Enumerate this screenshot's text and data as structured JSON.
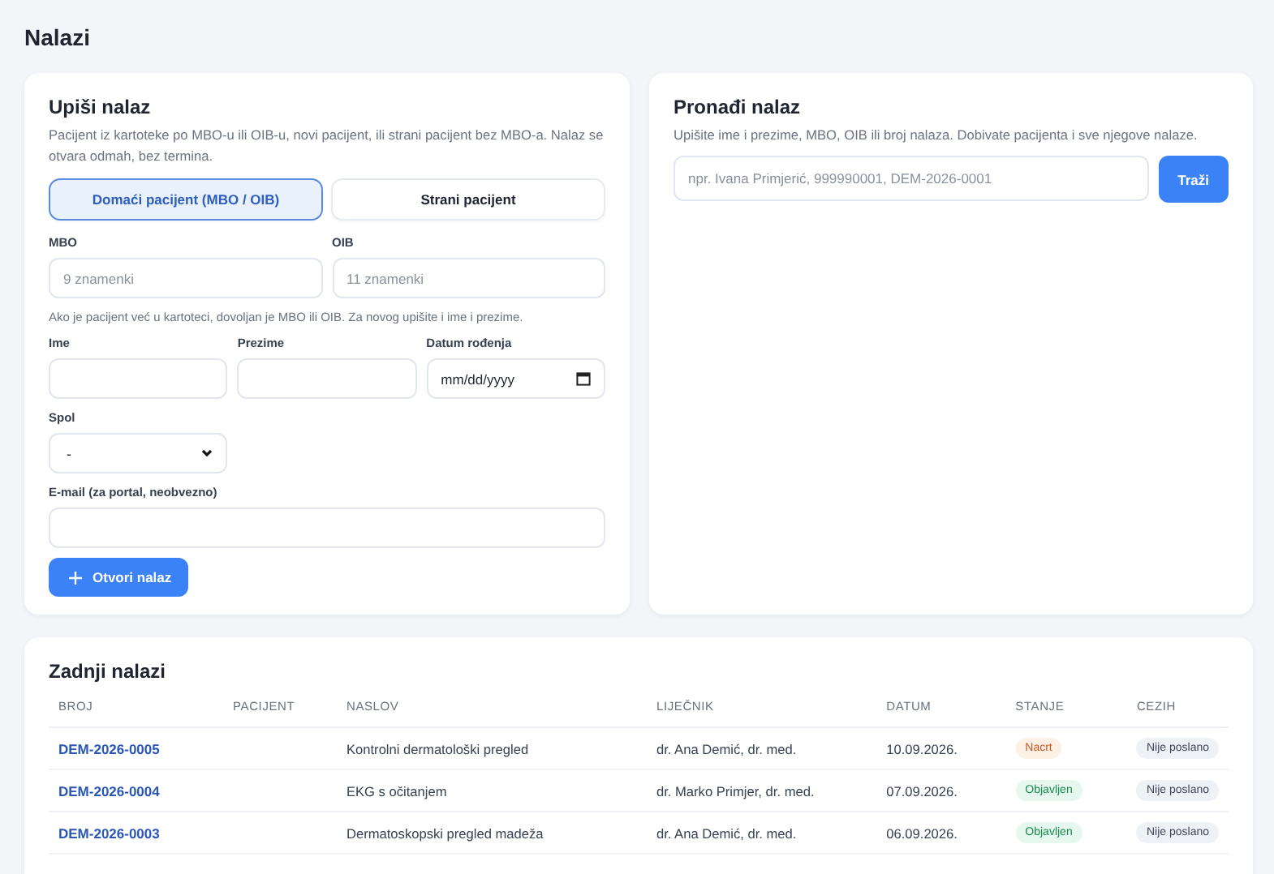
{
  "page": {
    "title": "Nalazi"
  },
  "new_finding": {
    "title": "Upiši nalaz",
    "description": "Pacijent iz kartoteke po MBO-u ili OIB-u, novi pacijent, ili strani pacijent bez MBO-a. Nalaz se otvara odmah, bez termina.",
    "patient_tabs": [
      {
        "label": "Domaći pacijent (MBO / OIB)",
        "selected": true
      },
      {
        "label": "Strani pacijent",
        "selected": false
      }
    ],
    "id_fields": [
      {
        "label": "MBO",
        "placeholder": "9 znamenki"
      },
      {
        "label": "OIB",
        "placeholder": "11 znamenki"
      }
    ],
    "hint": "Ako je pacijent već u kartoteci, dovoljan je MBO ili OIB. Za novog upišite i ime i prezime.",
    "name_fields": [
      {
        "label": "Ime",
        "kind": "text"
      },
      {
        "label": "Prezime",
        "kind": "text"
      },
      {
        "label": "Datum rođenja",
        "kind": "date",
        "placeholder": "mm/dd/yyyy"
      }
    ],
    "gender": {
      "label": "Spol",
      "value": "-"
    },
    "email": {
      "label": "E-mail (za portal, neobvezno)"
    },
    "submit_button": {
      "label": "Otvori nalaz"
    }
  },
  "find_finding": {
    "title": "Pronađi nalaz",
    "description": "Upišite ime i prezime, MBO, OIB ili broj nalaza. Dobivate pacijenta i sve njegove nalaze.",
    "search": {
      "placeholder": "npr. Ivana Primjerić, 999990001, DEM-2026-0001"
    },
    "search_button": {
      "label": "Traži"
    }
  },
  "recent": {
    "title": "Zadnji nalazi",
    "columns": [
      "BROJ",
      "PACIJENT",
      "NASLOV",
      "LIJEČNIK",
      "DATUM",
      "STANJE",
      "CEZIH"
    ],
    "rows": [
      {
        "number": "DEM-2026-0005",
        "title": "Kontrolni dermatološki pregled",
        "doctor": "dr. Ana Demić, dr. med.",
        "date": "10.09.2026.",
        "status": {
          "label": "Nacrt",
          "kind": "draft"
        },
        "cezih": "Nije poslano"
      },
      {
        "number": "DEM-2026-0004",
        "title": "EKG s očitanjem",
        "doctor": "dr. Marko Primjer, dr. med.",
        "date": "07.09.2026.",
        "status": {
          "label": "Objavljen",
          "kind": "published"
        },
        "cezih": "Nije poslano"
      },
      {
        "number": "DEM-2026-0003",
        "title": "Dermatoskopski pregled madeža",
        "doctor": "dr. Ana Demić, dr. med.",
        "date": "06.09.2026.",
        "status": {
          "label": "Objavljen",
          "kind": "published"
        },
        "cezih": "Nije poslano"
      }
    ]
  }
}
